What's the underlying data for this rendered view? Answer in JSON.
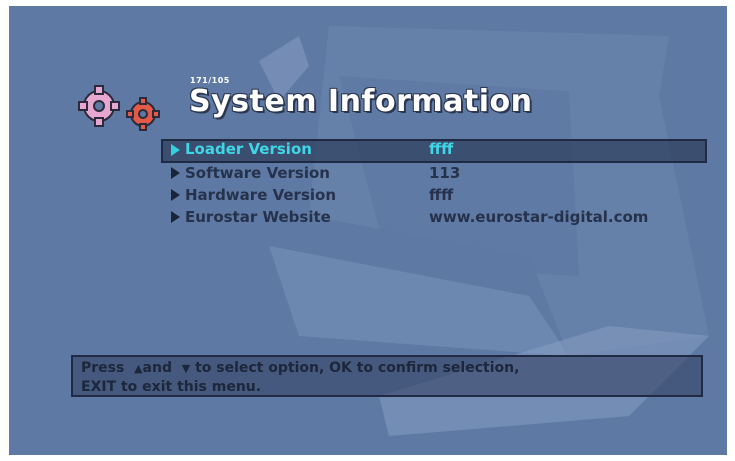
{
  "header": {
    "code": "171/105",
    "title": "System Information"
  },
  "menu": {
    "items": [
      {
        "label": "Loader Version",
        "value": "ffff",
        "selected": true
      },
      {
        "label": "Software Version",
        "value": "113",
        "selected": false
      },
      {
        "label": "Hardware Version",
        "value": "ffff",
        "selected": false
      },
      {
        "label": "Eurostar Website",
        "value": "www.eurostar-digital.com",
        "selected": false
      }
    ]
  },
  "help": {
    "press": "Press",
    "up_symbol": "▲",
    "and": "and",
    "down_symbol": "▼",
    "line1_rest": "to select option, OK to confirm selection,",
    "line2": "EXIT to exit this menu."
  },
  "icons": [
    "gears-icon",
    "right-arrow-icon"
  ],
  "colors": {
    "background": "#5e7aa4",
    "highlight": "#3fd7e8",
    "text": "#26314c"
  }
}
